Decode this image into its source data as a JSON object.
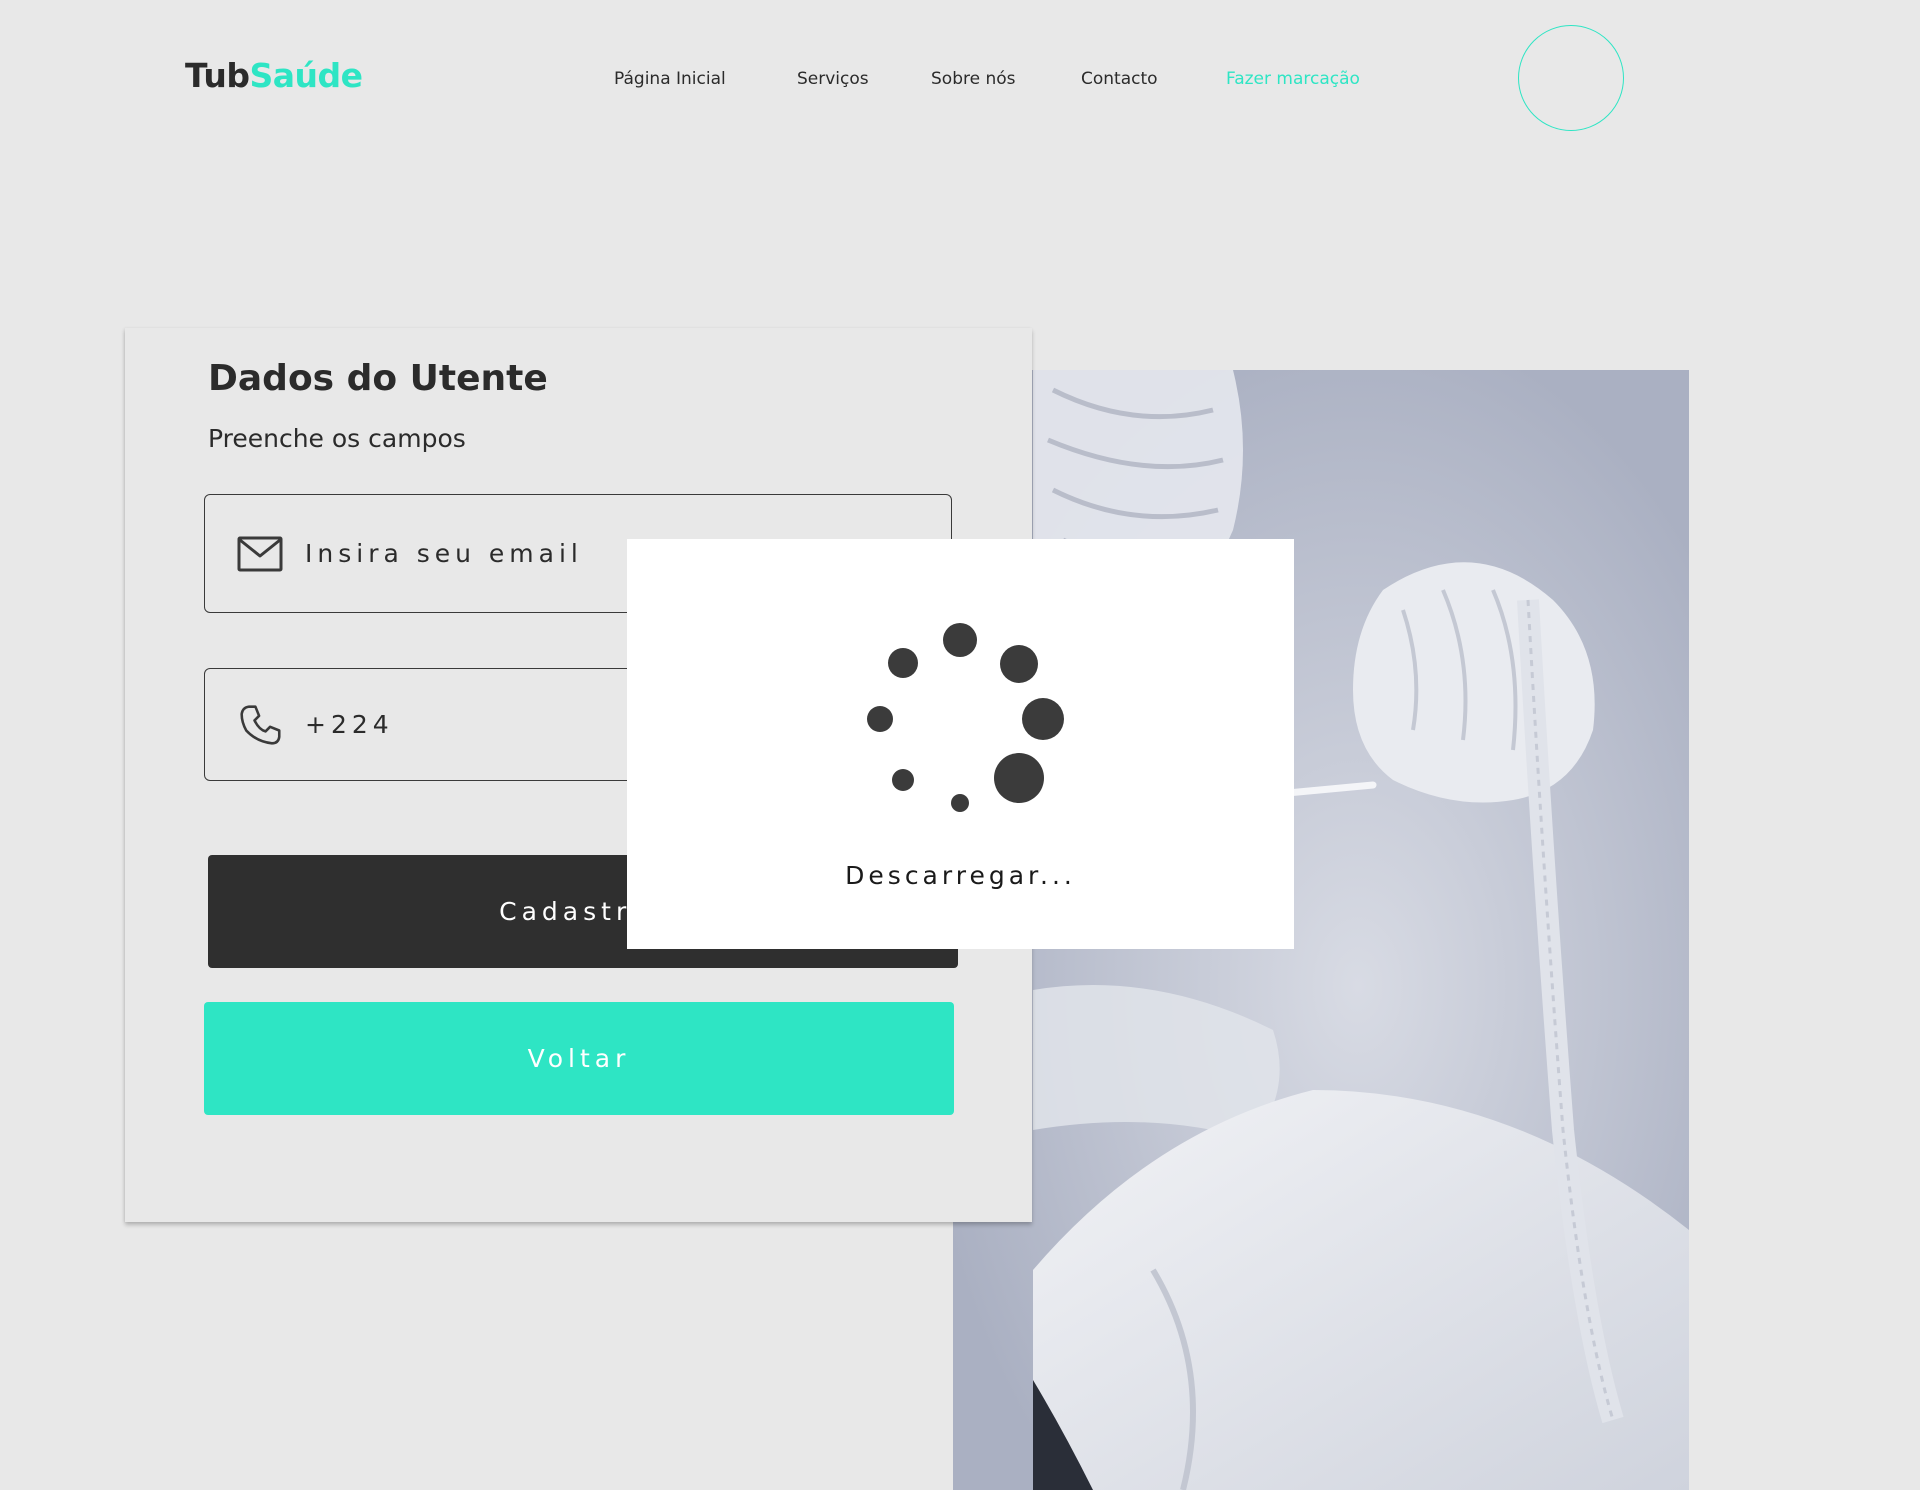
{
  "brand": {
    "name_part1": "Tub",
    "name_part2": "Saúde",
    "accent_color": "#2ee5c4"
  },
  "nav": {
    "items": [
      {
        "label": "Página Inicial",
        "active": false
      },
      {
        "label": "Serviços",
        "active": false
      },
      {
        "label": "Sobre nós",
        "active": false
      },
      {
        "label": "Contacto",
        "active": false
      },
      {
        "label": "Fazer marcação",
        "active": true
      }
    ]
  },
  "profile": {
    "icon": "user-avatar-circle"
  },
  "form": {
    "title": "Dados do Utente",
    "subtitle": "Preenche os campos",
    "email": {
      "icon": "envelope-icon",
      "placeholder": "Insira seu email",
      "value": ""
    },
    "phone": {
      "icon": "phone-icon",
      "value": "+224"
    },
    "submit_label": "Cadastrar",
    "back_label": "Voltar"
  },
  "loading": {
    "text": "Descarregar..."
  },
  "colors": {
    "background": "#e8e8e8",
    "dark": "#2f2f2f",
    "accent": "#2ee5c4"
  }
}
